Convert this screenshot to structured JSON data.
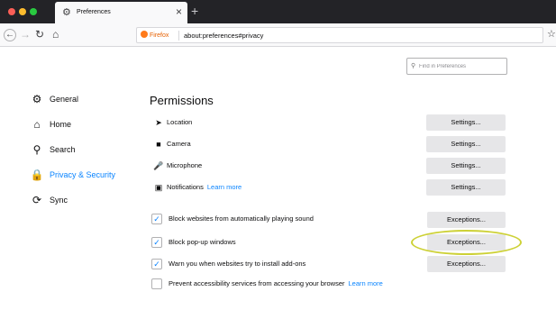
{
  "browser": {
    "tab_title": "Preferences",
    "tab_icon": "gear-icon",
    "url_badge": "Firefox",
    "url": "about:preferences#privacy"
  },
  "search": {
    "placeholder": "Find in Preferences"
  },
  "sidebar": {
    "items": [
      {
        "label": "General",
        "icon": "gear-icon",
        "selected": false
      },
      {
        "label": "Home",
        "icon": "home-icon",
        "selected": false
      },
      {
        "label": "Search",
        "icon": "search-icon",
        "selected": false
      },
      {
        "label": "Privacy & Security",
        "icon": "lock-icon",
        "selected": true
      },
      {
        "label": "Sync",
        "icon": "sync-icon",
        "selected": false
      }
    ]
  },
  "main": {
    "heading": "Permissions",
    "permissions": [
      {
        "label": "Location",
        "icon": "location-arrow-icon",
        "button": "Settings..."
      },
      {
        "label": "Camera",
        "icon": "camera-icon",
        "button": "Settings..."
      },
      {
        "label": "Microphone",
        "icon": "microphone-icon",
        "button": "Settings..."
      },
      {
        "label": "Notifications",
        "icon": "notification-icon",
        "button": "Settings...",
        "link": "Learn more"
      }
    ],
    "checkboxes": [
      {
        "label": "Block websites from automatically playing sound",
        "checked": true,
        "button": "Exceptions..."
      },
      {
        "label": "Block pop-up windows",
        "checked": true,
        "button": "Exceptions..."
      },
      {
        "label": "Warn you when websites try to install add-ons",
        "checked": true,
        "button": "Exceptions..."
      },
      {
        "label": "Prevent accessibility services from accessing your browser",
        "checked": false,
        "link": "Learn more"
      }
    ]
  },
  "colors": {
    "accent": "#0a84ff",
    "highlight": "#cdd136",
    "tabbar": "#232327"
  }
}
